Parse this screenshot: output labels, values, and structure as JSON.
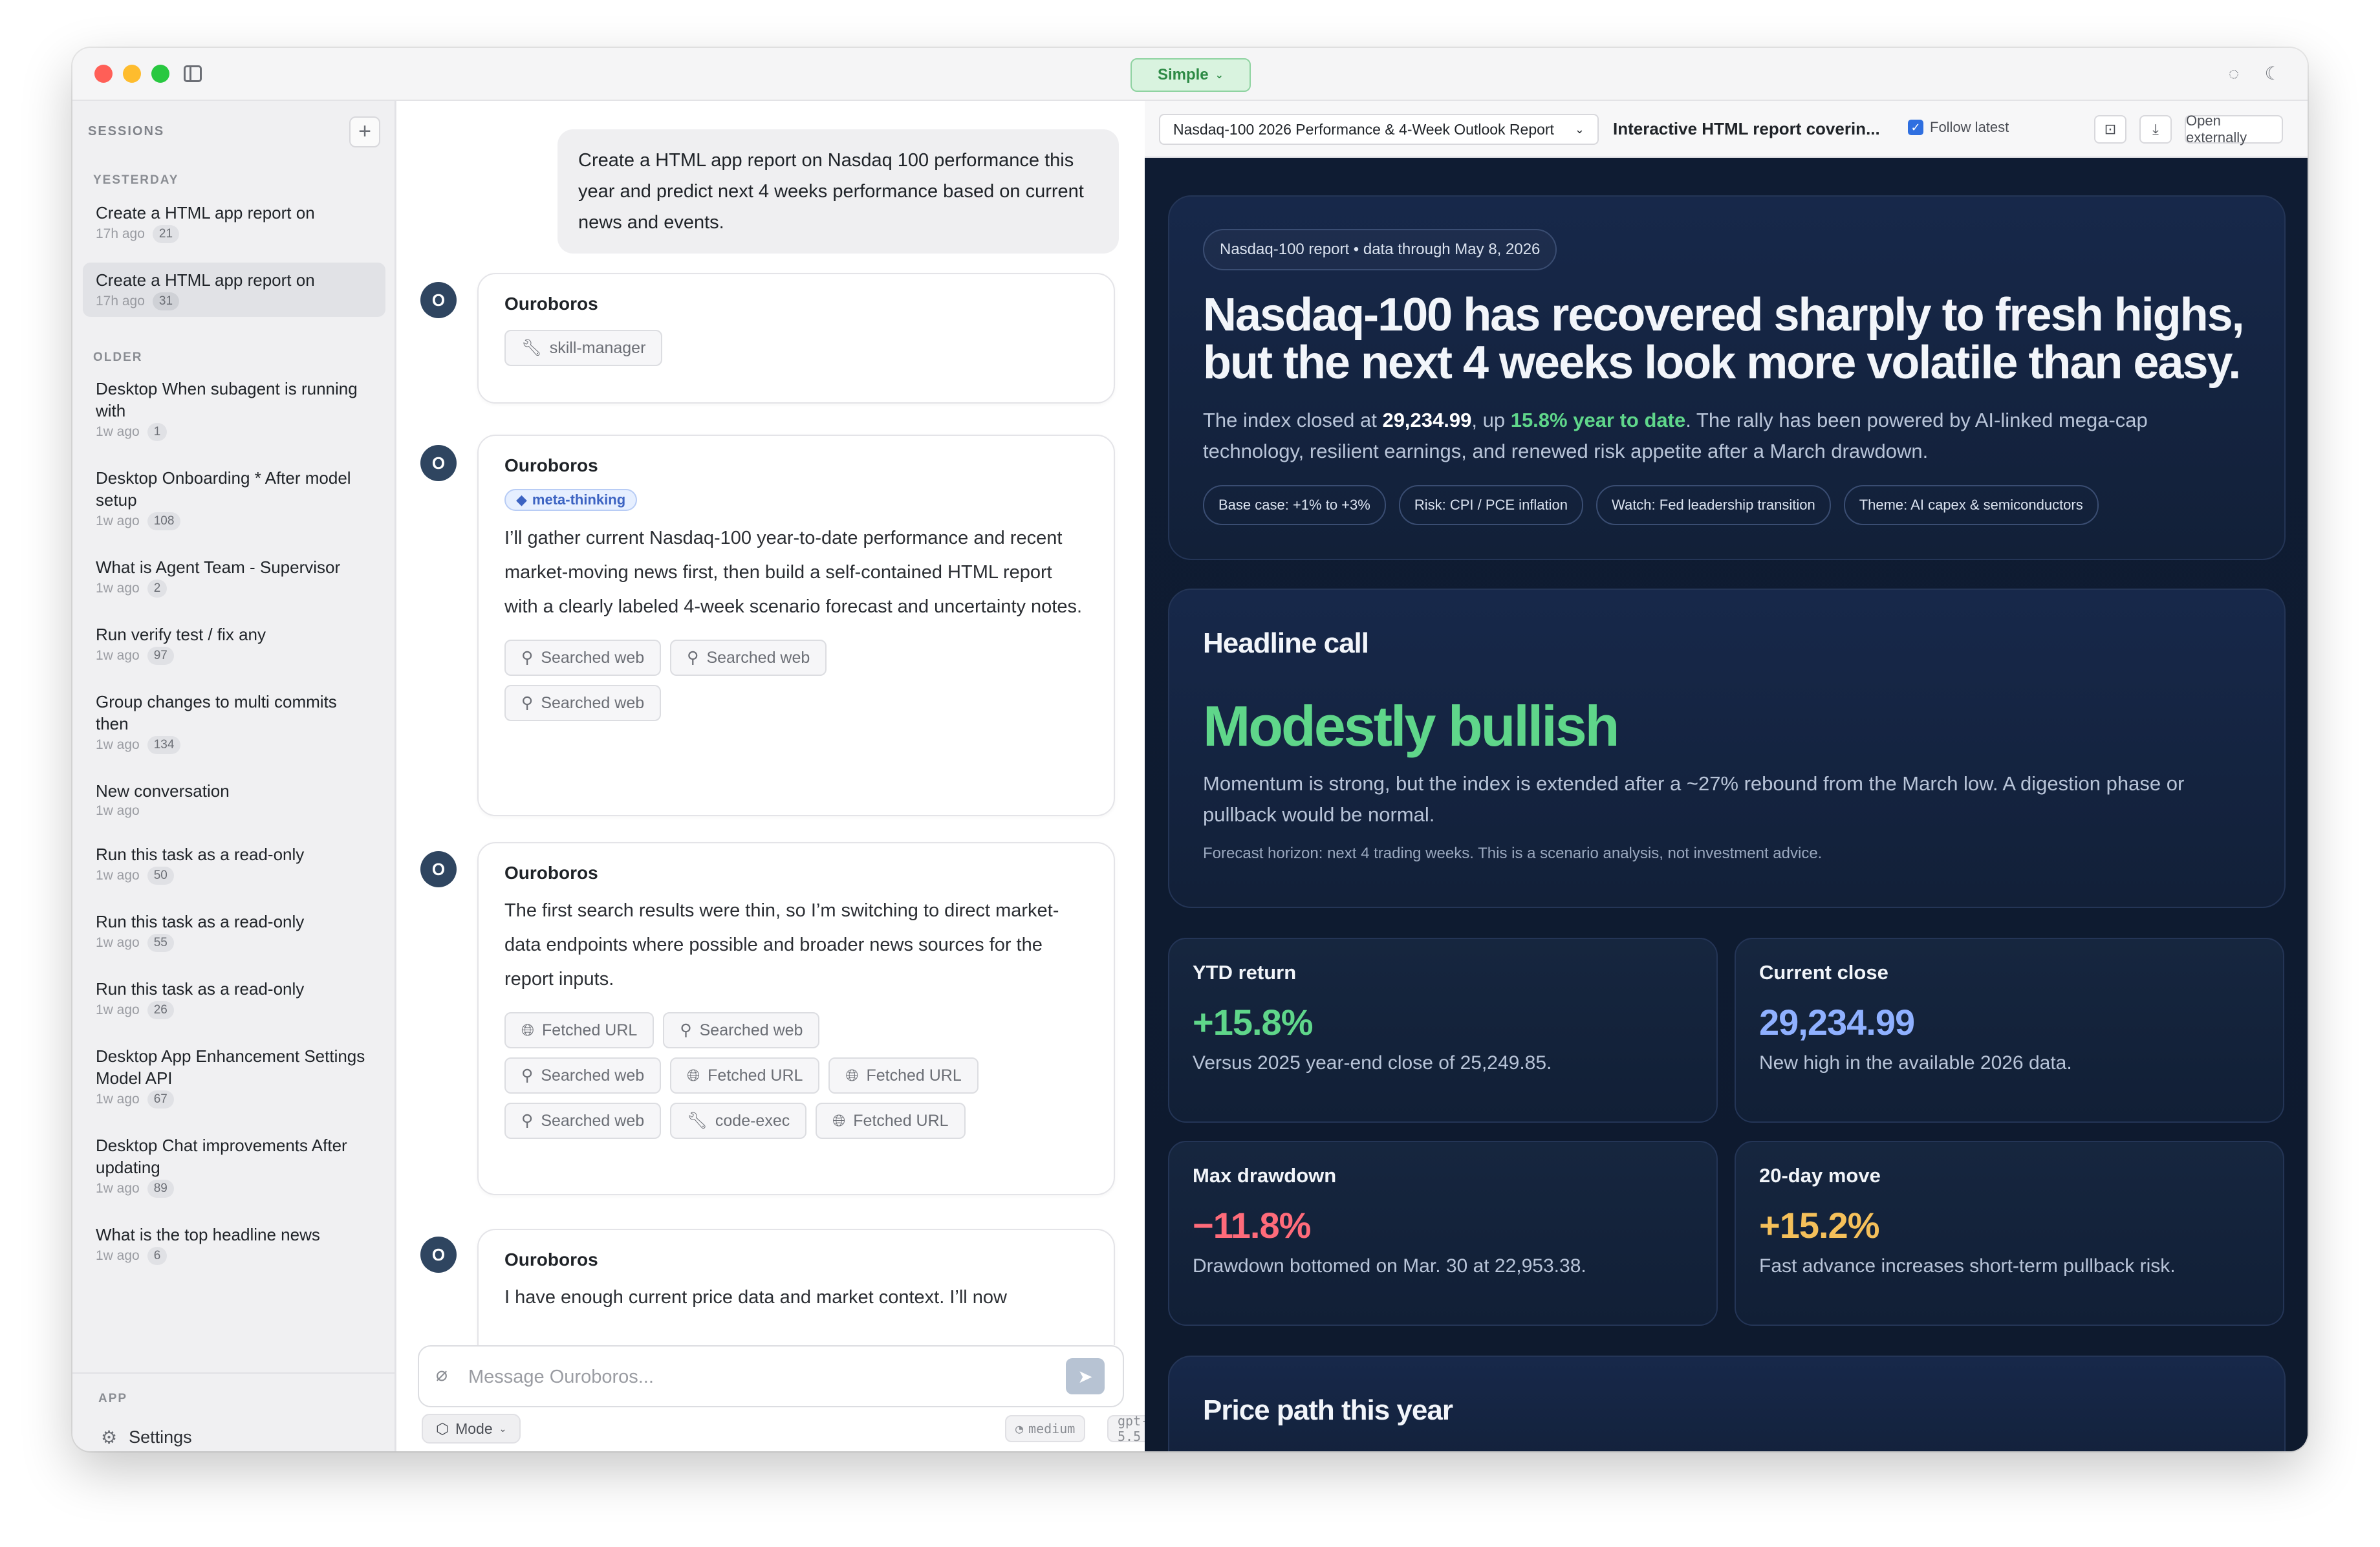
{
  "titlebar": {
    "mode_label": "Simple"
  },
  "sidebar": {
    "heading": "SESSIONS",
    "add_label": "+",
    "groups": [
      {
        "label": "YESTERDAY"
      },
      {
        "label": "OLDER"
      }
    ],
    "items": [
      {
        "title": "Create a HTML app report on",
        "time": "17h ago",
        "count": "21"
      },
      {
        "title": "Create a HTML app report on",
        "time": "17h ago",
        "count": "31"
      },
      {
        "title": "Desktop When subagent is running with",
        "time": "1w ago",
        "count": "1"
      },
      {
        "title": "Desktop Onboarding * After model setup",
        "time": "1w ago",
        "count": "108"
      },
      {
        "title": "What is Agent Team - Supervisor",
        "time": "1w ago",
        "count": "2"
      },
      {
        "title": "Run verify test / fix any",
        "time": "1w ago",
        "count": "97"
      },
      {
        "title": "Group changes to multi commits then",
        "time": "1w ago",
        "count": "134"
      },
      {
        "title": "New conversation",
        "time": "1w ago",
        "count": ""
      },
      {
        "title": "Run this task as a read-only",
        "time": "1w ago",
        "count": "50"
      },
      {
        "title": "Run this task as a read-only",
        "time": "1w ago",
        "count": "55"
      },
      {
        "title": "Run this task as a read-only",
        "time": "1w ago",
        "count": "26"
      },
      {
        "title": "Desktop App Enhancement Settings Model API",
        "time": "1w ago",
        "count": "67"
      },
      {
        "title": "Desktop Chat improvements After updating",
        "time": "1w ago",
        "count": "89"
      },
      {
        "title": "What is the top headline news",
        "time": "1w ago",
        "count": "6"
      }
    ],
    "app_label": "APP",
    "settings_label": "Settings"
  },
  "chat": {
    "user_message": "Create a HTML app report on Nasdaq 100 performance this year and predict next 4 weeks performance based on current news and events.",
    "avatar_letter": "O",
    "messages": [
      {
        "name": "Ouroboros",
        "chips": [
          "skill-manager"
        ]
      },
      {
        "name": "Ouroboros",
        "tag": "meta-thinking",
        "text": "I’ll gather current Nasdaq-100 year-to-date performance and recent market-moving news first, then build a self-contained HTML report with a clearly labeled 4-week scenario forecast and uncertainty notes.",
        "chips": [
          "Searched web",
          "Searched web",
          "Searched web"
        ]
      },
      {
        "name": "Ouroboros",
        "text": "The first search results were thin, so I’m switching to direct market-data endpoints where possible and broader news sources for the report inputs.",
        "chips": [
          "Fetched URL",
          "Searched web",
          "Searched web",
          "Fetched URL",
          "Fetched URL",
          "Searched web",
          "code-exec",
          "Fetched URL"
        ]
      },
      {
        "name": "Ouroboros",
        "text": "I have enough current price data and market context. I’ll now"
      }
    ],
    "composer_placeholder": "Message Ouroboros...",
    "mode_label": "Mode",
    "effort": "medium",
    "model": "gpt-5.5"
  },
  "preview": {
    "report_select": "Nasdaq-100 2026 Performance & 4-Week Outlook Report",
    "report_desc": "Interactive HTML report coverin...",
    "follow_label": "Follow latest",
    "open_label": "Open externally"
  },
  "report": {
    "pill": "Nasdaq-100 report • data through May 8, 2026",
    "title": "Nasdaq-100 has recovered sharply to fresh highs, but the next 4 weeks look more volatile than easy.",
    "lead_1": "The index closed at ",
    "lead_close": "29,234.99",
    "lead_2": ", up ",
    "lead_ytd": "15.8% year to date",
    "lead_3": ". The rally has been powered by AI-linked mega-cap technology, resilient earnings, and renewed risk appetite after a March drawdown.",
    "tags": [
      "Base case: +1% to +3%",
      "Risk: CPI / PCE inflation",
      "Watch: Fed leadership transition",
      "Theme: AI capex & semiconductors"
    ],
    "headline_heading": "Headline call",
    "headline_call": "Modestly bullish",
    "headline_text": "Momentum is strong, but the index is extended after a ~27% rebound from the March low. A digestion phase or pullback would be normal.",
    "headline_note": "Forecast horizon: next 4 trading weeks. This is a scenario analysis, not investment advice.",
    "stats": [
      {
        "label": "YTD return",
        "value": "+15.8%",
        "sub": "Versus 2025 year-end close of 25,249.85.",
        "color": "#5fd68a"
      },
      {
        "label": "Current close",
        "value": "29,234.99",
        "sub": "New high in the available 2026 data.",
        "color": "#8fb0ff"
      },
      {
        "label": "Max drawdown",
        "value": "−11.8%",
        "sub": "Drawdown bottomed on Mar. 30 at 22,953.38.",
        "color": "#ff6b7a"
      },
      {
        "label": "20-day move",
        "value": "+15.2%",
        "sub": "Fast advance increases short-term pullback risk.",
        "color": "#f5c05a"
      }
    ],
    "price_heading": "Price path this year"
  }
}
